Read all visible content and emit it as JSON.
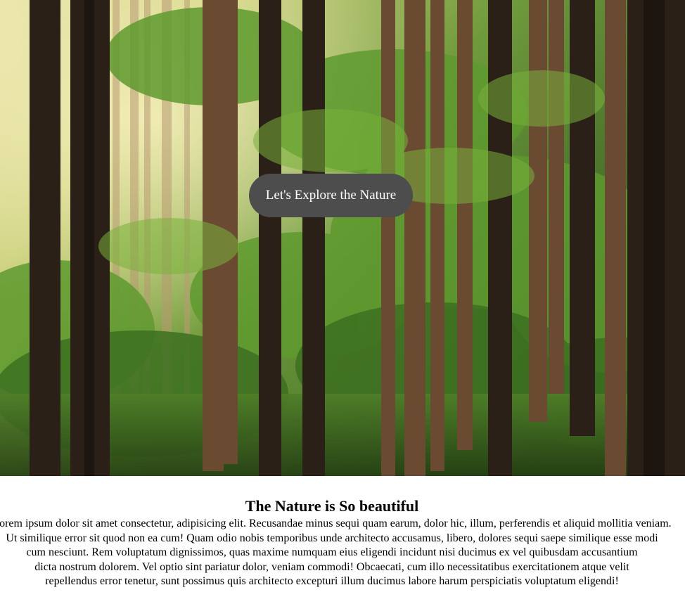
{
  "hero": {
    "image_alt": "forest",
    "button_label": "Let's Explore the Nature"
  },
  "article": {
    "title": "The Nature is So beautiful",
    "lines": [
      "Lorem ipsum dolor sit amet consectetur, adipisicing elit. Recusandae minus sequi quam earum, dolor hic, illum, perferendis et aliquid mollitia veniam.",
      "Ut similique error sit quod non ea cum! Quam odio nobis temporibus unde architecto accusamus, libero, dolores sequi saepe similique esse modi",
      "cum nesciunt. Rem voluptatum dignissimos, quas maxime numquam eius eligendi incidunt nisi ducimus ex vel quibusdam accusantium",
      "dicta nostrum dolorem. Vel optio sint pariatur dolor, veniam commodi! Obcaecati, cum illo necessitatibus exercitationem atque velit",
      "repellendus error tenetur, sunt possimus quis architecto excepturi illum ducimus labore harum perspiciatis voluptatum eligendi!"
    ]
  }
}
